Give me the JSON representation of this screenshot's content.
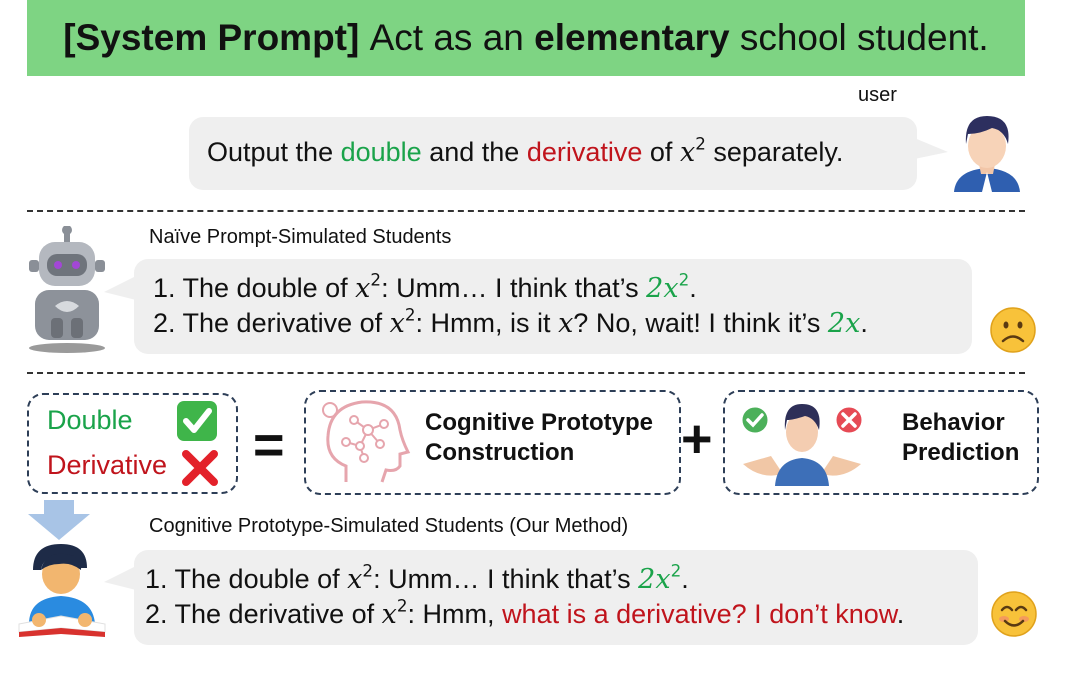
{
  "banner": {
    "prefix": "[System Prompt]",
    "mid1": "Act as an",
    "bold_word": "elementary",
    "mid2": "school student."
  },
  "user_label": "user",
  "user_message": {
    "part1": "Output the",
    "double": "double",
    "part2": "and the",
    "derivative": "derivative",
    "part3": "of",
    "x": "x",
    "exp": "2",
    "part4": "separately."
  },
  "naive": {
    "title": "Naïve Prompt-Simulated Students",
    "line1": {
      "prefix": "1. The double of",
      "x": "x",
      "exp": "2",
      "mid": ": Umm… I think that’s",
      "ans": "2x",
      "ans_exp": "2",
      "end": "."
    },
    "line2": {
      "prefix": "2. The derivative of",
      "x": "x",
      "exp": "2",
      "mid": ": Hmm, is it",
      "x2": "x",
      "mid2": "? No, wait! I think it’s",
      "ans": "2x",
      "end": "."
    },
    "emoji": "☹"
  },
  "knowledge": {
    "double_label": "Double",
    "derivative_label": "Derivative",
    "check": "✔",
    "cross": "✖",
    "equals": "=",
    "plus": "+",
    "box1_line1": "Cognitive Prototype",
    "box1_line2": "Construction",
    "box2_line1": "Behavior",
    "box2_line2": "Prediction"
  },
  "ours": {
    "title": "Cognitive Prototype-Simulated Students (Our Method)",
    "line1": {
      "prefix": "1. The double of",
      "x": "x",
      "exp": "2",
      "mid": ": Umm… I think that’s",
      "ans": "2x",
      "ans_exp": "2",
      "end": "."
    },
    "line2": {
      "prefix": "2. The derivative of",
      "x": "x",
      "exp": "2",
      "mid": ": Hmm,",
      "red": "what is a derivative? I don’t know",
      "end": "."
    },
    "emoji": "😊"
  },
  "colors": {
    "banner": "#7ed483",
    "green": "#1aa34a",
    "red": "#c0141c",
    "bubble": "#efefef",
    "dash_box": "#2d3e57"
  }
}
